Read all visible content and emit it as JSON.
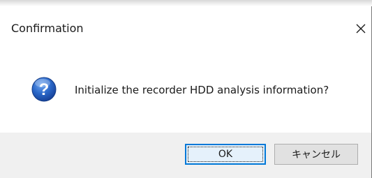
{
  "dialog": {
    "title": "Confirmation",
    "message": "Initialize the recorder HDD analysis information?",
    "icon": "question-icon",
    "buttons": {
      "ok_label": "OK",
      "cancel_label": "キャンセル"
    }
  },
  "colors": {
    "icon_blue": "#1f5fc4",
    "ok_border": "#0078d7",
    "footer_bg": "#f0f0f0"
  }
}
